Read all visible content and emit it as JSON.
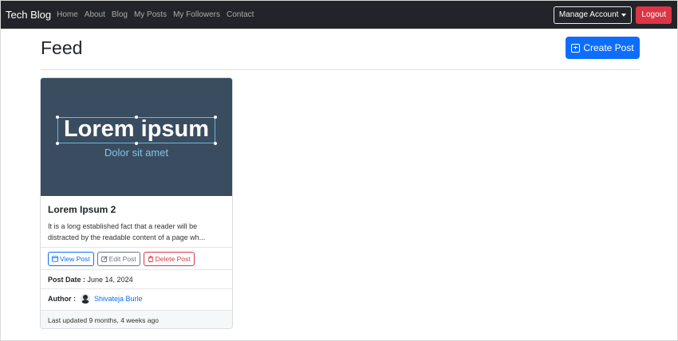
{
  "navbar": {
    "brand": "Tech Blog",
    "links": [
      "Home",
      "About",
      "Blog",
      "My Posts",
      "My Followers",
      "Contact"
    ],
    "manage_account": "Manage Account",
    "logout": "Logout"
  },
  "page": {
    "title": "Feed",
    "create_post": "Create Post"
  },
  "post": {
    "image_title": "Lorem ipsum",
    "image_subtitle": "Dolor sit amet",
    "title": "Lorem Ipsum 2",
    "excerpt": "It is a long established fact that a reader will be distracted by the readable content of a page wh...",
    "view_label": "View Post",
    "edit_label": "Edit Post",
    "delete_label": "Delete Post",
    "date_label": "Post Date :",
    "date": "June 14, 2024",
    "author_label": "Author :",
    "author": "Shivateja Burle",
    "last_updated": "Last updated 9 months, 4 weeks ago"
  },
  "colors": {
    "primary": "#0d6efd",
    "danger": "#dc3545",
    "navbar": "#212529",
    "image_bg": "#3a4c60",
    "image_subtitle": "#7fc6e6"
  }
}
